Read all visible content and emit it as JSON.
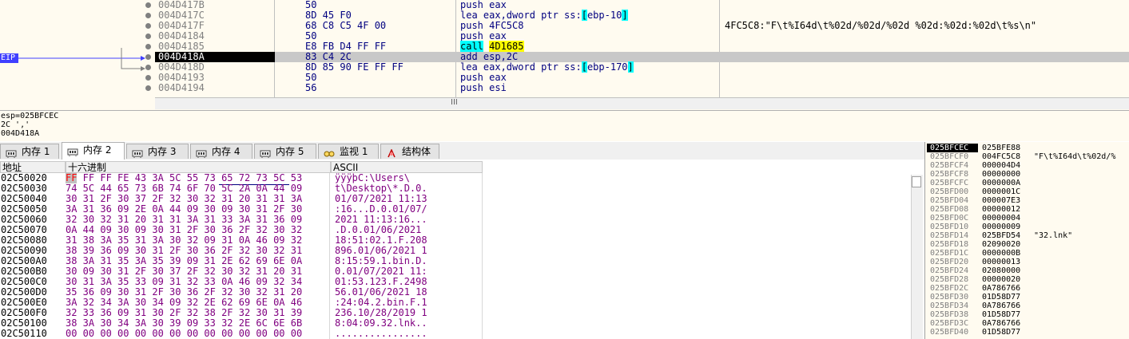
{
  "disasm": {
    "rows": [
      {
        "addr": "004D417B",
        "bytes": "50",
        "asm": "push eax",
        "comment": ""
      },
      {
        "addr": "004D417C",
        "bytes": "8D 45 F0",
        "asm_pre": "lea eax,dword ptr ss:",
        "asm_br": "[",
        "asm_mid": "ebp-10",
        "asm_br2": "]",
        "comment": ""
      },
      {
        "addr": "004D417F",
        "bytes": "68 C8 C5 4F 00",
        "asm": "push 4FC5C8",
        "comment": "4FC5C8:\"F\\t%I64d\\t%02d/%02d/%02d %02d:%02d:%02d\\t%s\\n\""
      },
      {
        "addr": "004D4184",
        "bytes": "50",
        "asm": "push eax",
        "comment": ""
      },
      {
        "addr": "004D4185",
        "bytes": "E8 FB D4 FF FF",
        "asm_call": "call",
        "asm_target": "4D1685",
        "comment": ""
      },
      {
        "addr": "004D418A",
        "bytes": "83 C4 2C",
        "asm": "add esp,2C",
        "comment": ""
      },
      {
        "addr": "004D418D",
        "bytes": "8D 85 90 FE FF FF",
        "asm_pre": "lea eax,dword ptr ss:",
        "asm_br": "[",
        "asm_mid": "ebp-170",
        "asm_br2": "]",
        "comment": ""
      },
      {
        "addr": "004D4193",
        "bytes": "50",
        "asm": "push eax",
        "comment": ""
      },
      {
        "addr": "004D4194",
        "bytes": "56",
        "asm": "push esi",
        "comment": ""
      }
    ],
    "eip_label": "EIP",
    "scroll_mark": "III"
  },
  "info": {
    "line1": "esp=025BFCEC",
    "line2": "2C ','",
    "line3": "004D418A"
  },
  "tabs": [
    {
      "label": "内存 1",
      "icon": "memory-icon",
      "active": false
    },
    {
      "label": "内存 2",
      "icon": "memory-icon",
      "active": true
    },
    {
      "label": "内存 3",
      "icon": "memory-icon",
      "active": false
    },
    {
      "label": "内存 4",
      "icon": "memory-icon",
      "active": false
    },
    {
      "label": "内存 5",
      "icon": "memory-icon",
      "active": false
    },
    {
      "label": "监视 1",
      "icon": "watch-icon",
      "active": false
    },
    {
      "label": "结构体",
      "icon": "struct-icon",
      "active": false
    }
  ],
  "dump": {
    "headers": {
      "addr": "地址",
      "hex": "十六进制",
      "ascii": "ASCII"
    },
    "rows": [
      {
        "addr": "02C50020",
        "hex_sel": "FF",
        "hex": " FF FF FE 43 3A 5C 55 73 65 72 73 5C 53",
        "ascii": "ÿÿÿþC:\\Users\\"
      },
      {
        "addr": "02C50030",
        "hex": "74 5C 44 65 73 6B 74 6F 70 5C 2A 0A 44 09",
        "ascii": "t\\Desktop\\*.D.0."
      },
      {
        "addr": "02C50040",
        "hex": "30 31 2F 30 37 2F 32 30 32 31 20 31 31 3A",
        "ascii": "01/07/2021 11:13"
      },
      {
        "addr": "02C50050",
        "hex": "3A 31 36 09 2E 0A 44 09 30 09 30 31 2F 30",
        "ascii": ":16...D.0.01/07/"
      },
      {
        "addr": "02C50060",
        "hex": "32 30 32 31 20 31 31 3A 31 33 3A 31 36 09",
        "ascii": "2021 11:13:16..."
      },
      {
        "addr": "02C50070",
        "hex": "0A 44 09 30 09 30 31 2F 30 36 2F 32 30 32",
        "ascii": ".D.0.01/06/2021"
      },
      {
        "addr": "02C50080",
        "hex": "31 38 3A 35 31 3A 30 32 09 31 0A 46 09 32",
        "ascii": "18:51:02.1.F.208"
      },
      {
        "addr": "02C50090",
        "hex": "38 39 36 09 30 31 2F 30 36 2F 32 30 32 31",
        "ascii": "896.01/06/2021 1"
      },
      {
        "addr": "02C500A0",
        "hex": "38 3A 31 35 3A 35 39 09 31 2E 62 69 6E 0A",
        "ascii": "8:15:59.1.bin.D."
      },
      {
        "addr": "02C500B0",
        "hex": "30 09 30 31 2F 30 37 2F 32 30 32 31 20 31",
        "ascii": "0.01/07/2021 11:"
      },
      {
        "addr": "02C500C0",
        "hex": "30 31 3A 35 33 09 31 32 33 0A 46 09 32 34",
        "ascii": "01:53.123.F.2498"
      },
      {
        "addr": "02C500D0",
        "hex": "35 36 09 30 31 2F 30 36 2F 32 30 32 31 20",
        "ascii": "56.01/06/2021 18"
      },
      {
        "addr": "02C500E0",
        "hex": "3A 32 34 3A 30 34 09 32 2E 62 69 6E 0A 46",
        "ascii": ":24:04.2.bin.F.1"
      },
      {
        "addr": "02C500F0",
        "hex": "32 33 36 09 31 30 2F 32 38 2F 32 30 31 39",
        "ascii": "236.10/28/2019 1"
      },
      {
        "addr": "02C50100",
        "hex": "38 3A 30 34 3A 30 39 09 33 32 2E 6C 6E 6B",
        "ascii": "8:04:09.32.lnk.."
      },
      {
        "addr": "02C50110",
        "hex": "00 00 00 00 00 00 00 00 00 00 00 00 00 00",
        "ascii": "................"
      }
    ]
  },
  "stack": {
    "rows": [
      {
        "addr": "025BFCEC",
        "val": "025BFE88",
        "cmt": ""
      },
      {
        "addr": "025BFCF0",
        "val": "004FC5C8",
        "cmt": "\"F\\t%I64d\\t%02d/%"
      },
      {
        "addr": "025BFCF4",
        "val": "000004D4",
        "cmt": ""
      },
      {
        "addr": "025BFCF8",
        "val": "00000000",
        "cmt": ""
      },
      {
        "addr": "025BFCFC",
        "val": "0000000A",
        "cmt": ""
      },
      {
        "addr": "025BFD00",
        "val": "0000001C",
        "cmt": ""
      },
      {
        "addr": "025BFD04",
        "val": "000007E3",
        "cmt": ""
      },
      {
        "addr": "025BFD08",
        "val": "00000012",
        "cmt": ""
      },
      {
        "addr": "025BFD0C",
        "val": "00000004",
        "cmt": ""
      },
      {
        "addr": "025BFD10",
        "val": "00000009",
        "cmt": ""
      },
      {
        "addr": "025BFD14",
        "val": "025BFD54",
        "cmt": "\"32.lnk\""
      },
      {
        "addr": "025BFD18",
        "val": "02090020",
        "cmt": ""
      },
      {
        "addr": "025BFD1C",
        "val": "0000000B",
        "cmt": ""
      },
      {
        "addr": "025BFD20",
        "val": "00000013",
        "cmt": ""
      },
      {
        "addr": "025BFD24",
        "val": "02080000",
        "cmt": ""
      },
      {
        "addr": "025BFD28",
        "val": "00000020",
        "cmt": ""
      },
      {
        "addr": "025BFD2C",
        "val": "0A786766",
        "cmt": ""
      },
      {
        "addr": "025BFD30",
        "val": "01D58D77",
        "cmt": ""
      },
      {
        "addr": "025BFD34",
        "val": "0A786766",
        "cmt": ""
      },
      {
        "addr": "025BFD38",
        "val": "01D58D77",
        "cmt": ""
      },
      {
        "addr": "025BFD3C",
        "val": "0A786766",
        "cmt": ""
      },
      {
        "addr": "025BFD40",
        "val": "01D58D77",
        "cmt": ""
      }
    ]
  },
  "colors": {
    "eip": "#4040ff",
    "call_hl": "#00ffff",
    "target_hl": "#ffff00",
    "hex": "#800080",
    "code": "#000080"
  }
}
